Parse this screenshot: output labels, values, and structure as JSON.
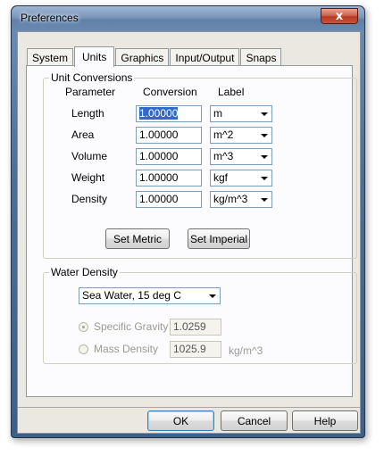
{
  "window": {
    "title": "Preferences",
    "close_glyph": "x"
  },
  "tabs": [
    {
      "label": "System"
    },
    {
      "label": "Units"
    },
    {
      "label": "Graphics"
    },
    {
      "label": "Input/Output"
    },
    {
      "label": "Snaps"
    }
  ],
  "active_tab": "Units",
  "unit_conversions": {
    "legend": "Unit Conversions",
    "headers": {
      "parameter": "Parameter",
      "conversion": "Conversion",
      "label": "Label"
    },
    "rows": [
      {
        "parameter": "Length",
        "conversion": "1.00000",
        "label": "m"
      },
      {
        "parameter": "Area",
        "conversion": "1.00000",
        "label": "m^2"
      },
      {
        "parameter": "Volume",
        "conversion": "1.00000",
        "label": "m^3"
      },
      {
        "parameter": "Weight",
        "conversion": "1.00000",
        "label": "kgf"
      },
      {
        "parameter": "Density",
        "conversion": "1.00000",
        "label": "kg/m^3"
      }
    ],
    "set_metric": "Set Metric",
    "set_imperial": "Set Imperial"
  },
  "water_density": {
    "legend": "Water Density",
    "selected": "Sea Water, 15 deg C",
    "specific_gravity_label": "Specific Gravity",
    "specific_gravity_value": "1.0259",
    "mass_density_label": "Mass Density",
    "mass_density_value": "1025.9",
    "mass_density_unit": "kg/m^3"
  },
  "buttons": {
    "ok": "OK",
    "cancel": "Cancel",
    "help": "Help"
  },
  "colors": {
    "title_bar": "#7896bb",
    "close_button": "#c9533a",
    "selection": "#316ac5"
  }
}
